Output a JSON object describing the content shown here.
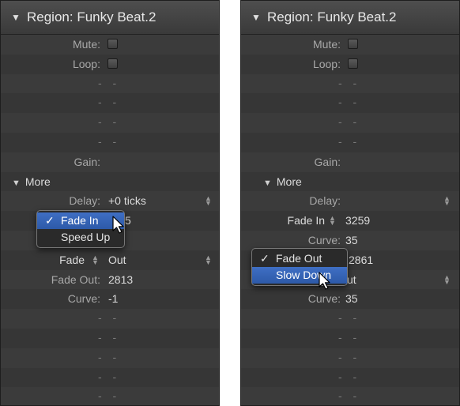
{
  "left_panel": {
    "header": {
      "title": "Region: Funky Beat.2"
    },
    "mute_label": "Mute:",
    "loop_label": "Loop:",
    "dash": "- -",
    "gain_label": "Gain:",
    "more_label": "More",
    "delay_label": "Delay:",
    "delay_value": "+0 ticks",
    "hidden_value_fragment": "5",
    "fade_label": "Fade",
    "fade_value": "Out",
    "fade_out_label": "Fade Out:",
    "fade_out_value": "2813",
    "curve_label": "Curve:",
    "curve_value": "-1",
    "popup": {
      "items": [
        {
          "label": "Fade In",
          "checked": true
        },
        {
          "label": "Speed Up",
          "checked": false
        }
      ]
    }
  },
  "right_panel": {
    "header": {
      "title": "Region: Funky Beat.2"
    },
    "mute_label": "Mute:",
    "loop_label": "Loop:",
    "dash": "- -",
    "gain_label": "Gain:",
    "more_label": "More",
    "delay_label": "Delay:",
    "fade_in_label": "Fade In",
    "fade_in_value": "3259",
    "curve_label": "Curve:",
    "curve1_value": "35",
    "hidden_value_fragment": "2861",
    "fade_out_value_fragment": "ut",
    "curve2_value": "35",
    "popup": {
      "items": [
        {
          "label": "Fade Out",
          "checked": true
        },
        {
          "label": "Slow Down",
          "checked": false
        }
      ]
    }
  },
  "symbols": {
    "check": "✓",
    "triangle_down": "▼",
    "step_up": "▲",
    "step_down": "▼"
  },
  "colors": {
    "panel_bg": "#3c3c3c",
    "selection_blue": "#2d5aa8"
  }
}
